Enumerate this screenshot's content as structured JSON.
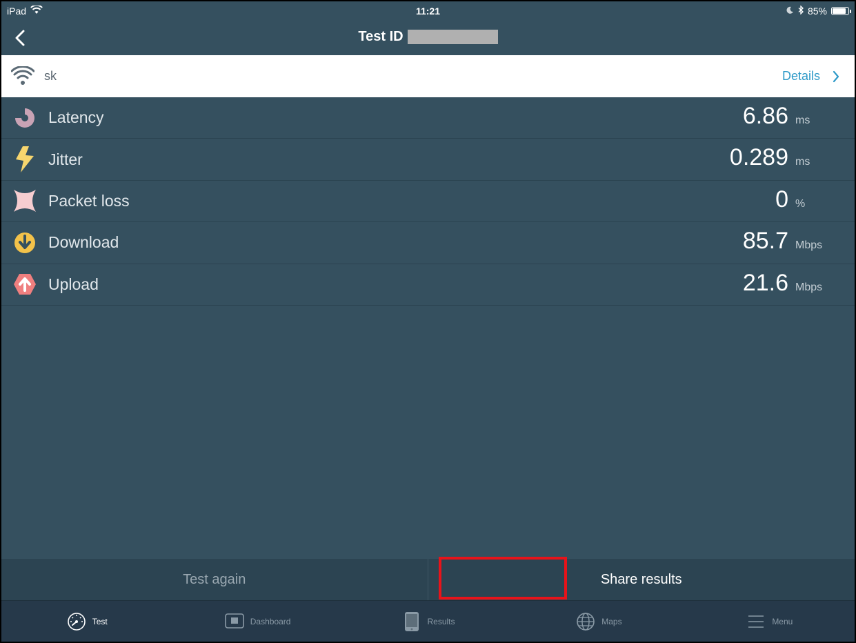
{
  "status_bar": {
    "device": "iPad",
    "time": "11:21",
    "battery": "85%",
    "battery_level": 0.85
  },
  "nav": {
    "title": "Test ID"
  },
  "network": {
    "name": "sk",
    "details_label": "Details"
  },
  "metrics": [
    {
      "label": "Latency",
      "value": "6.86",
      "unit": "ms",
      "icon": "latency-icon",
      "color": "#c9a3b5"
    },
    {
      "label": "Jitter",
      "value": "0.289",
      "unit": "ms",
      "icon": "lightning-icon",
      "color": "#f7d66e"
    },
    {
      "label": "Packet loss",
      "value": "0",
      "unit": "%",
      "icon": "packet-loss-icon",
      "color": "#f6cdd0"
    },
    {
      "label": "Download",
      "value": "85.7",
      "unit": "Mbps",
      "icon": "download-icon",
      "color": "#f3c24a"
    },
    {
      "label": "Upload",
      "value": "21.6",
      "unit": "Mbps",
      "icon": "upload-icon",
      "color": "#ef7f7f"
    }
  ],
  "actions": {
    "test_again": "Test again",
    "share_results": "Share results"
  },
  "tabs": [
    {
      "label": "Test",
      "icon": "speedometer-icon",
      "active": true
    },
    {
      "label": "Dashboard",
      "icon": "dashboard-icon",
      "active": false
    },
    {
      "label": "Results",
      "icon": "tablet-icon",
      "active": false
    },
    {
      "label": "Maps",
      "icon": "globe-icon",
      "active": false
    },
    {
      "label": "Menu",
      "icon": "hamburger-icon",
      "active": false
    }
  ],
  "colors": {
    "background": "#35505f",
    "accent": "#2e9ac8",
    "highlight": "#e8131a"
  }
}
